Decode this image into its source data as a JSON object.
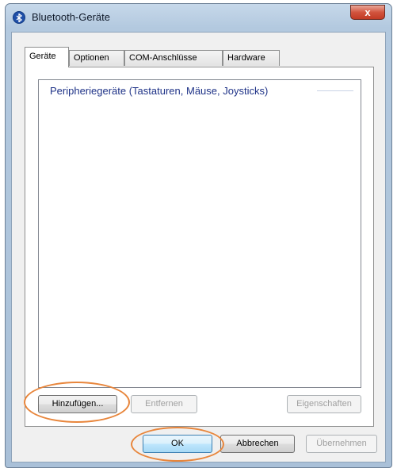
{
  "window": {
    "title": "Bluetooth-Geräte",
    "close_label": "x"
  },
  "tabs": [
    {
      "label": "Geräte",
      "active": true
    },
    {
      "label": "Optionen",
      "active": false
    },
    {
      "label": "COM-Anschlüsse",
      "active": false
    },
    {
      "label": "Hardware",
      "active": false
    }
  ],
  "device_list": {
    "group_header": "Peripheriegeräte (Tastaturen, Mäuse, Joysticks)",
    "items": []
  },
  "panel_buttons": {
    "add": {
      "label": "Hinzufügen...",
      "enabled": true
    },
    "remove": {
      "label": "Entfernen",
      "enabled": false
    },
    "properties": {
      "label": "Eigenschaften",
      "enabled": false
    }
  },
  "dialog_buttons": {
    "ok": {
      "label": "OK",
      "enabled": true
    },
    "cancel": {
      "label": "Abbrechen",
      "enabled": true
    },
    "apply": {
      "label": "Übernehmen",
      "enabled": false
    }
  },
  "colors": {
    "highlight": "#e8863c",
    "group_header": "#1e3287",
    "bluetooth_icon": "#1f4fa8"
  },
  "icons": {
    "window_icon": "bluetooth-icon",
    "close": "close-icon"
  }
}
